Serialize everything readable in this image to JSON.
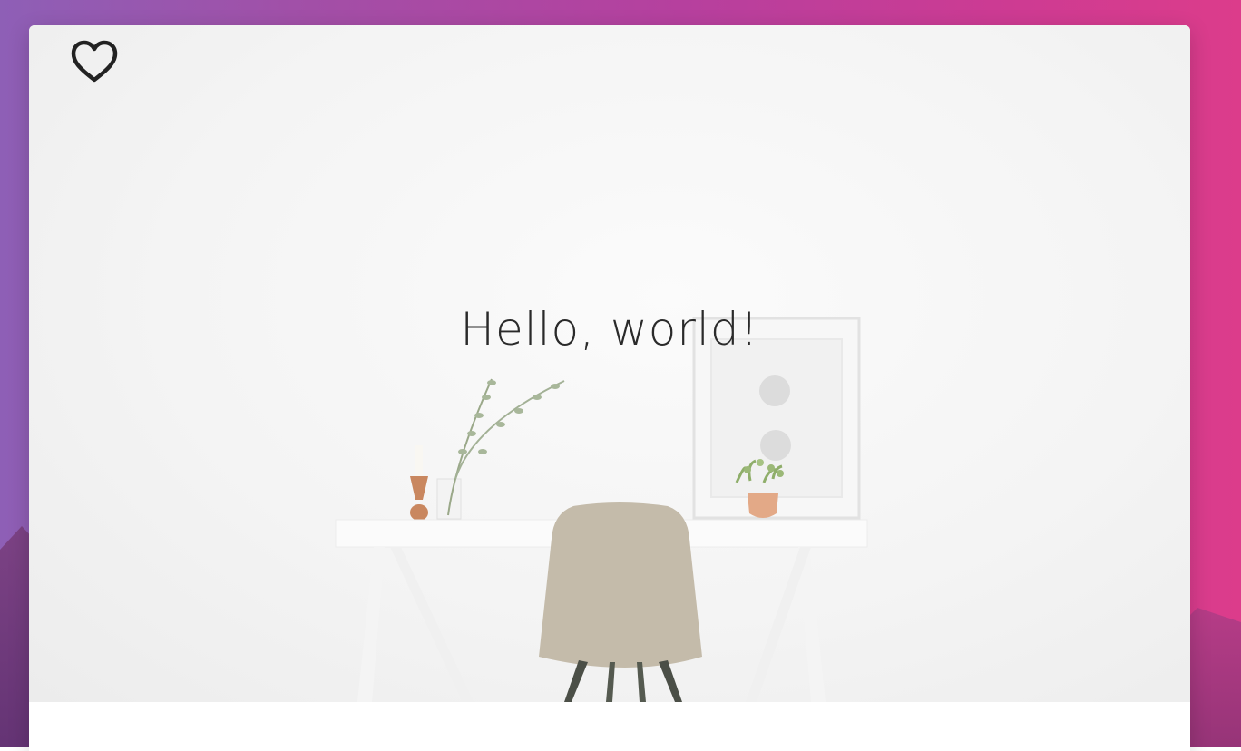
{
  "hero": {
    "title": "Hello, world!"
  },
  "icons": {
    "favorite": "heart-outline-icon"
  },
  "colors": {
    "gradient_start": "#8e5fb6",
    "gradient_end": "#dc3c8b",
    "title_text": "#2a2a2a",
    "card": "#ffffff"
  }
}
